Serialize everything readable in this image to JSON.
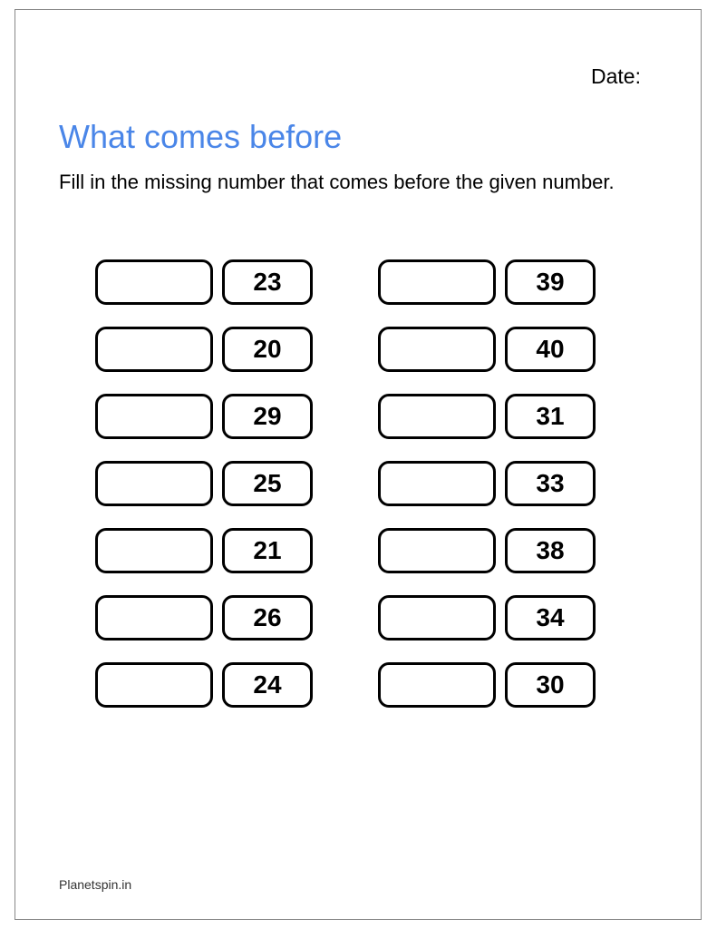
{
  "header": {
    "date_label": "Date:"
  },
  "title": "What comes before",
  "instructions": "Fill in the missing number that comes before the given number.",
  "columns": [
    {
      "items": [
        {
          "blank": "",
          "given": "23"
        },
        {
          "blank": "",
          "given": "20"
        },
        {
          "blank": "",
          "given": "29"
        },
        {
          "blank": "",
          "given": "25"
        },
        {
          "blank": "",
          "given": "21"
        },
        {
          "blank": "",
          "given": "26"
        },
        {
          "blank": "",
          "given": "24"
        }
      ]
    },
    {
      "items": [
        {
          "blank": "",
          "given": "39"
        },
        {
          "blank": "",
          "given": "40"
        },
        {
          "blank": "",
          "given": "31"
        },
        {
          "blank": "",
          "given": "33"
        },
        {
          "blank": "",
          "given": "38"
        },
        {
          "blank": "",
          "given": "34"
        },
        {
          "blank": "",
          "given": "30"
        }
      ]
    }
  ],
  "footer": "Planetspin.in"
}
